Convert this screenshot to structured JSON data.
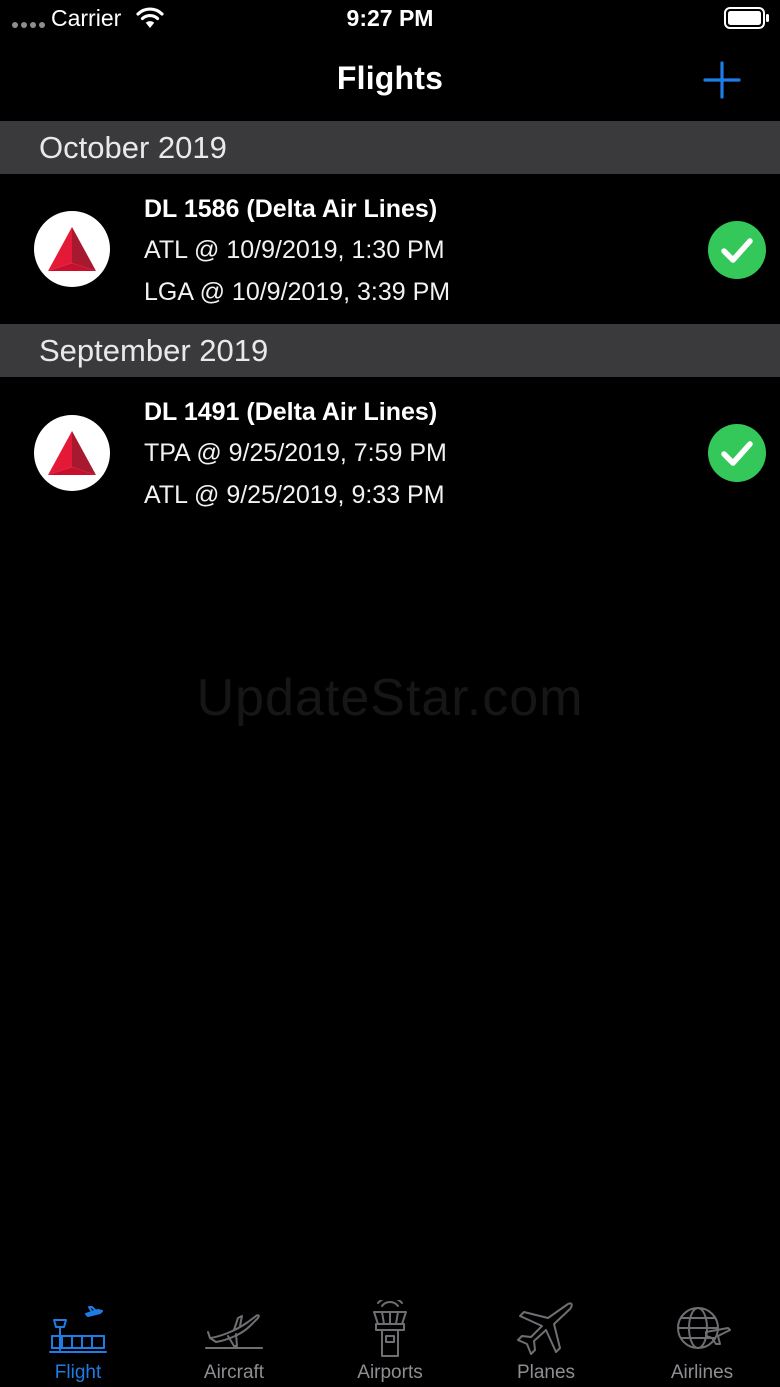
{
  "status_bar": {
    "carrier": "Carrier",
    "time": "9:27 PM"
  },
  "nav": {
    "title": "Flights",
    "add_icon": "plus-icon",
    "accent_color": "#1e7ce6"
  },
  "sections": [
    {
      "header": "October 2019",
      "flights": [
        {
          "title": "DL 1586 (Delta Air Lines)",
          "departure": "ATL @ 10/9/2019, 1:30 PM",
          "arrival": "LGA @ 10/9/2019, 3:39 PM",
          "logo_icon": "delta-logo-icon",
          "status_icon": "checkmark-icon"
        }
      ]
    },
    {
      "header": "September 2019",
      "flights": [
        {
          "title": "DL 1491 (Delta Air Lines)",
          "departure": "TPA @ 9/25/2019, 7:59 PM",
          "arrival": "ATL @ 9/25/2019, 9:33 PM",
          "logo_icon": "delta-logo-icon",
          "status_icon": "checkmark-icon"
        }
      ]
    }
  ],
  "watermark": "UpdateStar.com",
  "tabs": [
    {
      "label": "Flight",
      "icon": "flight-tower-icon",
      "active": true
    },
    {
      "label": "Aircraft",
      "icon": "aircraft-icon",
      "active": false
    },
    {
      "label": "Airports",
      "icon": "airport-tower-icon",
      "active": false
    },
    {
      "label": "Planes",
      "icon": "plane-icon",
      "active": false
    },
    {
      "label": "Airlines",
      "icon": "globe-plane-icon",
      "active": false
    }
  ],
  "colors": {
    "section_header_bg": "#3a3a3c",
    "status_green": "#34c759",
    "delta_red": "#c8102e",
    "tab_inactive": "#8e8e93"
  }
}
